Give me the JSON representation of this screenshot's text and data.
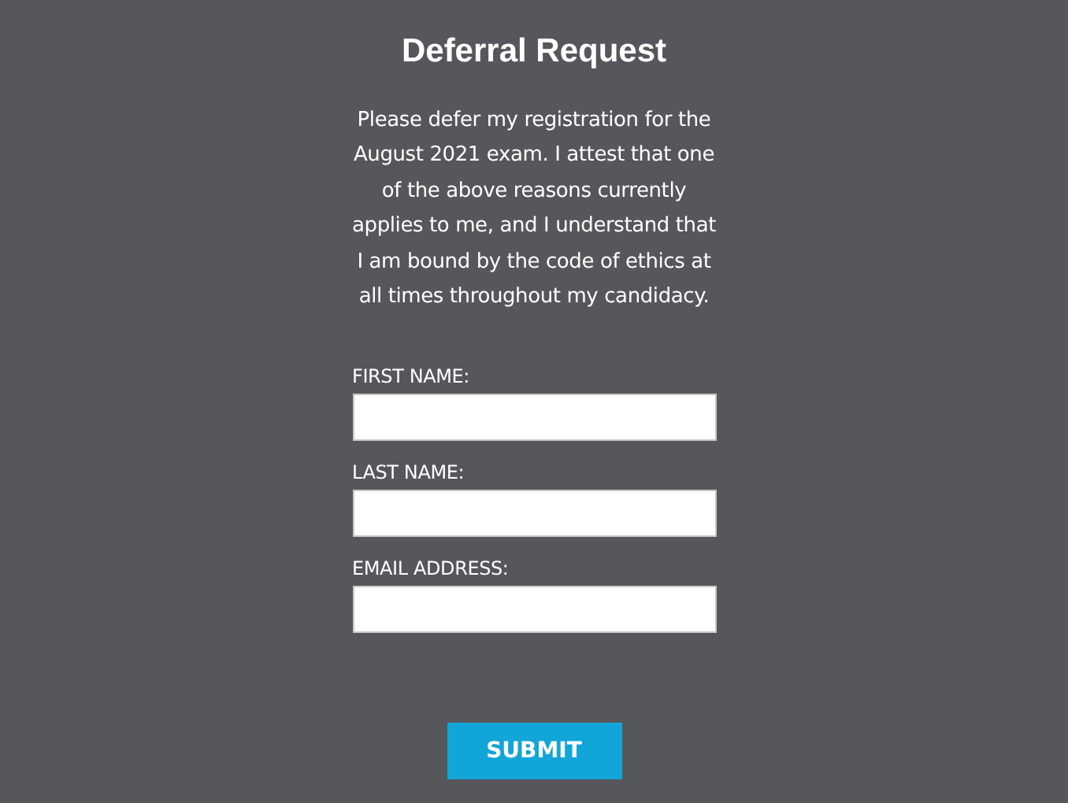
{
  "title": "Deferral Request",
  "statement": "Please defer my registration for the August 2021 exam. I attest that one of the above reasons currently applies to me, and I understand that I am bound by the code of ethics at all times throughout my candidacy.",
  "fields": [
    {
      "label": "FIRST NAME:"
    },
    {
      "label": "LAST NAME:"
    },
    {
      "label": "EMAIL ADDRESS:"
    }
  ],
  "submit": "SUBMIT"
}
